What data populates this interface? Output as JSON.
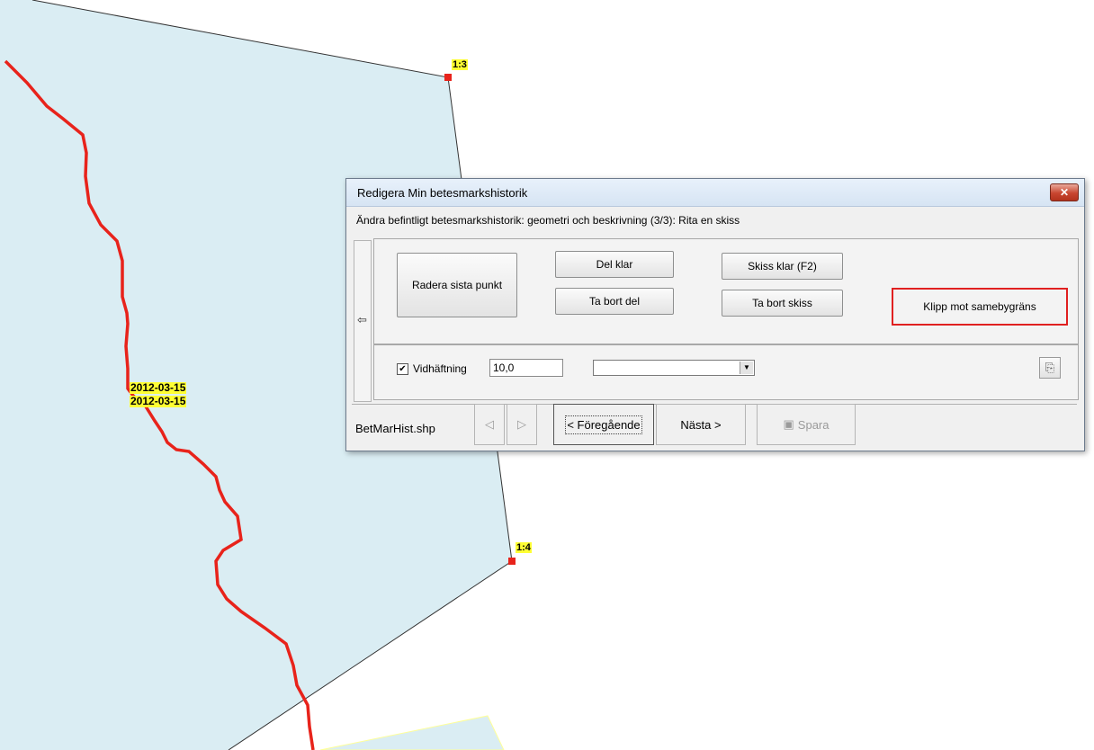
{
  "map": {
    "vertex_labels": [
      "1:3",
      "1:4"
    ],
    "date_labels": [
      "2012-03-15",
      "2012-03-15"
    ],
    "colors": {
      "polygon_fill": "#daedf3",
      "line": "#e8231b",
      "vertex": "#e8231b",
      "label_bg": "#ffff33"
    }
  },
  "dialog": {
    "title": "Redigera Min betesmarkshistorik",
    "close_icon": "close-icon",
    "subtitle": "Ändra befintligt betesmarkshistorik: geometri och beskrivning (3/3): Rita en skiss",
    "back_icon": "back-arrow-icon",
    "buttons": {
      "delete_last_point": "Radera sista punkt",
      "part_done": "Del klar",
      "remove_part": "Ta bort del",
      "sketch_done": "Skiss klar (F2)",
      "remove_sketch": "Ta bort skiss",
      "clip": "Klipp mot samebygräns"
    },
    "snapping": {
      "checked": true,
      "label": "Vidhäftning",
      "value": "10,0"
    },
    "layer_combo": {
      "selected": ""
    },
    "tool_icon": "edit-layer-icon",
    "footer": {
      "filename": "BetMarHist.shp",
      "prev_icon": "arrow-left-icon",
      "next_icon": "arrow-right-icon",
      "previous": "< Föregående",
      "next": "Nästa >",
      "save": "Spara",
      "save_icon": "floppy-icon"
    }
  }
}
